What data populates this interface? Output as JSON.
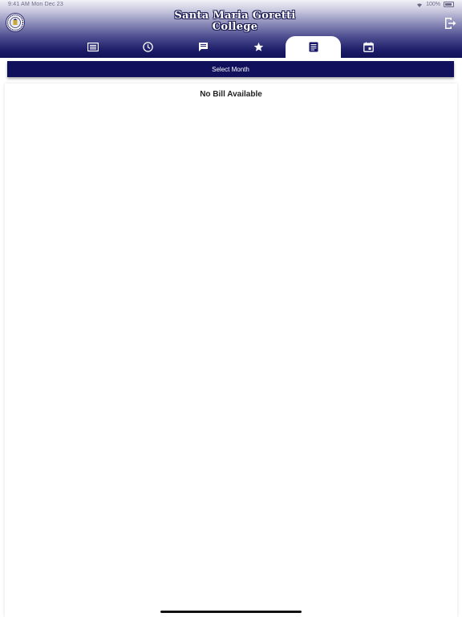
{
  "status_bar": {
    "time_date": "9:41 AM  Mon Dec 23",
    "battery": "100%"
  },
  "header": {
    "title_line1": "Santa Maria Goretti",
    "title_line2": "College",
    "logout_icon": "logout-icon"
  },
  "tabs": [
    {
      "icon": "message-list-icon",
      "active": false
    },
    {
      "icon": "clock-icon",
      "active": false
    },
    {
      "icon": "chat-bubble-icon",
      "active": false
    },
    {
      "icon": "star-icon",
      "active": false
    },
    {
      "icon": "document-icon",
      "active": true
    },
    {
      "icon": "calendar-icon",
      "active": false
    }
  ],
  "billing": {
    "select_month_label": "Select Month",
    "empty_message": "No Bill Available"
  },
  "colors": {
    "header_dark": "#111159",
    "button_bg": "#10105c",
    "active_tab_bg": "#ffffff"
  }
}
